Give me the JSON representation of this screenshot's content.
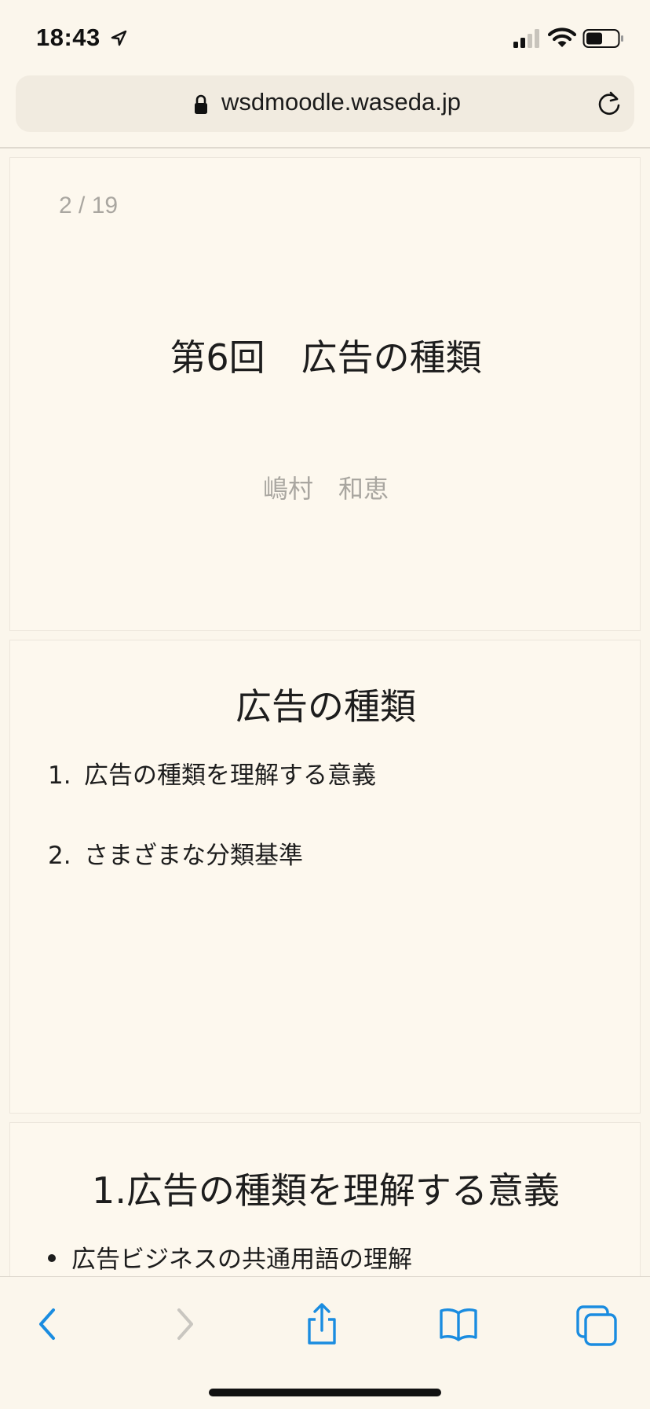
{
  "status_bar": {
    "time": "18:43",
    "icons": [
      "location-arrow-icon",
      "cellular-signal-icon",
      "wifi-icon",
      "battery-icon"
    ]
  },
  "browser": {
    "url": "wsdmoodle.waseda.jp",
    "icons": [
      "lock-icon",
      "reload-icon"
    ]
  },
  "slides": [
    {
      "page_indicator": "2 / 19",
      "title": "第6回　広告の種類",
      "author": "嶋村　和恵"
    },
    {
      "heading": "広告の種類",
      "items": [
        {
          "num": "1.",
          "text": "広告の種類を理解する意義"
        },
        {
          "num": "2.",
          "text": "さまざまな分類基準"
        }
      ]
    },
    {
      "heading": "1.広告の種類を理解する意義",
      "bullets": [
        "広告ビジネスの共通用語の理解"
      ]
    }
  ],
  "toolbar": {
    "buttons": [
      "back-icon",
      "forward-icon",
      "share-icon",
      "bookmarks-icon",
      "tabs-icon"
    ]
  },
  "colors": {
    "background": "#fbf6ec",
    "accent_blue": "#1a8ce0",
    "disabled_gray": "#c9c6c0",
    "muted_text": "#a9a6a0"
  }
}
